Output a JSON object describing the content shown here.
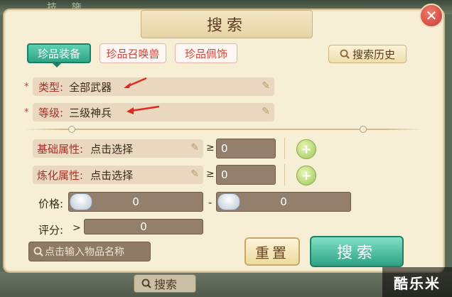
{
  "background": {
    "top_text": "技  施",
    "bottom_search_label": "搜索",
    "watermark": "酷乐米"
  },
  "dialog": {
    "title": "搜索",
    "close_glyph": "✕"
  },
  "tabs": [
    {
      "label": "珍品装备",
      "active": true
    },
    {
      "label": "珍品召唤兽",
      "active": false
    },
    {
      "label": "珍品佩饰",
      "active": false
    }
  ],
  "history_button": "搜索历史",
  "fields": {
    "type": {
      "label": "类型:",
      "value": "全部武器",
      "required_mark": "*"
    },
    "level": {
      "label": "等级:",
      "value": "三级神兵",
      "required_mark": "*"
    }
  },
  "attributes": {
    "base": {
      "label": "基础属性:",
      "placeholder": "点击选择",
      "compare": "≥",
      "value": "0"
    },
    "refine": {
      "label": "炼化属性:",
      "placeholder": "点击选择",
      "compare": "≥",
      "value": "0"
    }
  },
  "price": {
    "label": "价格:",
    "min": "0",
    "separator": "-",
    "max": "0"
  },
  "score": {
    "label": "评分:",
    "compare": ">",
    "value": "0"
  },
  "name_input": {
    "placeholder": "点击输入物品名称"
  },
  "buttons": {
    "reset": "重置",
    "search": "搜索"
  },
  "colors": {
    "tab_active": "#2fa585",
    "tab_inactive_text": "#d1443a",
    "field_bg": "#e9d7bf",
    "number_box": "#937f6b",
    "search_button": "#2ea184",
    "annotation_arrow": "#e02a1d"
  },
  "icons": [
    "close-icon",
    "search-icon",
    "pencil-icon",
    "plus-icon",
    "silver-ingot-icon",
    "red-arrow-icon"
  ]
}
